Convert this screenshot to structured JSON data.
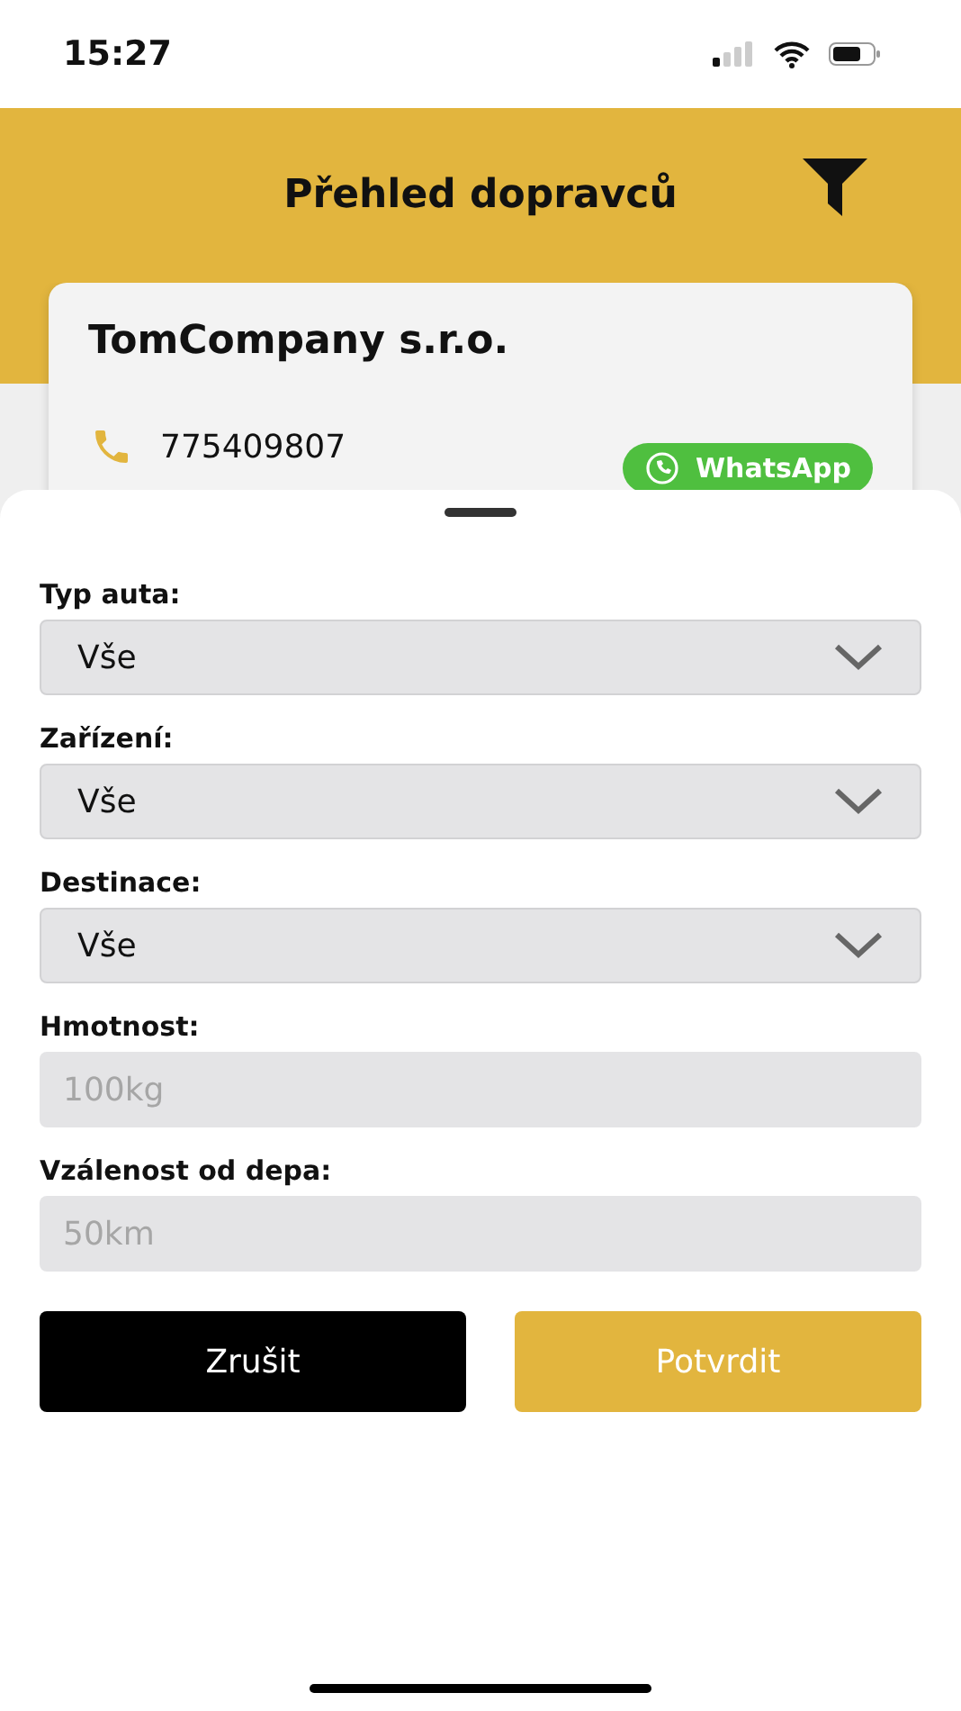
{
  "status_bar": {
    "time": "15:27"
  },
  "header": {
    "title": "Přehled dopravců"
  },
  "card": {
    "company": "TomCompany s.r.o.",
    "phone": "775409807",
    "whatsapp": "WhatsApp"
  },
  "filter_sheet": {
    "fields": [
      {
        "kind": "select",
        "label": "Typ auta:",
        "value": "Vše"
      },
      {
        "kind": "select",
        "label": "Zařízení:",
        "value": "Vše"
      },
      {
        "kind": "select",
        "label": "Destinace:",
        "value": "Vše"
      },
      {
        "kind": "input",
        "label": "Hmotnost:",
        "placeholder": "100kg"
      },
      {
        "kind": "input",
        "label": "Vzálenost od depa:",
        "placeholder": "50km"
      }
    ],
    "buttons": [
      {
        "kind": "secondary",
        "label": "Zrušit"
      },
      {
        "kind": "primary",
        "label": "Potvrdit"
      }
    ]
  }
}
